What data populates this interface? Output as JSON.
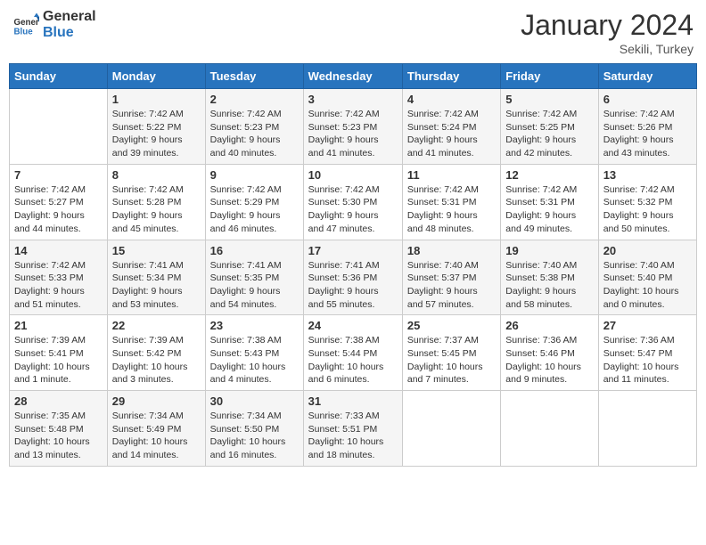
{
  "header": {
    "logo_line1": "General",
    "logo_line2": "Blue",
    "month": "January 2024",
    "location": "Sekili, Turkey"
  },
  "weekdays": [
    "Sunday",
    "Monday",
    "Tuesday",
    "Wednesday",
    "Thursday",
    "Friday",
    "Saturday"
  ],
  "weeks": [
    [
      {
        "day": "",
        "info": ""
      },
      {
        "day": "1",
        "info": "Sunrise: 7:42 AM\nSunset: 5:22 PM\nDaylight: 9 hours\nand 39 minutes."
      },
      {
        "day": "2",
        "info": "Sunrise: 7:42 AM\nSunset: 5:23 PM\nDaylight: 9 hours\nand 40 minutes."
      },
      {
        "day": "3",
        "info": "Sunrise: 7:42 AM\nSunset: 5:23 PM\nDaylight: 9 hours\nand 41 minutes."
      },
      {
        "day": "4",
        "info": "Sunrise: 7:42 AM\nSunset: 5:24 PM\nDaylight: 9 hours\nand 41 minutes."
      },
      {
        "day": "5",
        "info": "Sunrise: 7:42 AM\nSunset: 5:25 PM\nDaylight: 9 hours\nand 42 minutes."
      },
      {
        "day": "6",
        "info": "Sunrise: 7:42 AM\nSunset: 5:26 PM\nDaylight: 9 hours\nand 43 minutes."
      }
    ],
    [
      {
        "day": "7",
        "info": "Sunrise: 7:42 AM\nSunset: 5:27 PM\nDaylight: 9 hours\nand 44 minutes."
      },
      {
        "day": "8",
        "info": "Sunrise: 7:42 AM\nSunset: 5:28 PM\nDaylight: 9 hours\nand 45 minutes."
      },
      {
        "day": "9",
        "info": "Sunrise: 7:42 AM\nSunset: 5:29 PM\nDaylight: 9 hours\nand 46 minutes."
      },
      {
        "day": "10",
        "info": "Sunrise: 7:42 AM\nSunset: 5:30 PM\nDaylight: 9 hours\nand 47 minutes."
      },
      {
        "day": "11",
        "info": "Sunrise: 7:42 AM\nSunset: 5:31 PM\nDaylight: 9 hours\nand 48 minutes."
      },
      {
        "day": "12",
        "info": "Sunrise: 7:42 AM\nSunset: 5:31 PM\nDaylight: 9 hours\nand 49 minutes."
      },
      {
        "day": "13",
        "info": "Sunrise: 7:42 AM\nSunset: 5:32 PM\nDaylight: 9 hours\nand 50 minutes."
      }
    ],
    [
      {
        "day": "14",
        "info": "Sunrise: 7:42 AM\nSunset: 5:33 PM\nDaylight: 9 hours\nand 51 minutes."
      },
      {
        "day": "15",
        "info": "Sunrise: 7:41 AM\nSunset: 5:34 PM\nDaylight: 9 hours\nand 53 minutes."
      },
      {
        "day": "16",
        "info": "Sunrise: 7:41 AM\nSunset: 5:35 PM\nDaylight: 9 hours\nand 54 minutes."
      },
      {
        "day": "17",
        "info": "Sunrise: 7:41 AM\nSunset: 5:36 PM\nDaylight: 9 hours\nand 55 minutes."
      },
      {
        "day": "18",
        "info": "Sunrise: 7:40 AM\nSunset: 5:37 PM\nDaylight: 9 hours\nand 57 minutes."
      },
      {
        "day": "19",
        "info": "Sunrise: 7:40 AM\nSunset: 5:38 PM\nDaylight: 9 hours\nand 58 minutes."
      },
      {
        "day": "20",
        "info": "Sunrise: 7:40 AM\nSunset: 5:40 PM\nDaylight: 10 hours\nand 0 minutes."
      }
    ],
    [
      {
        "day": "21",
        "info": "Sunrise: 7:39 AM\nSunset: 5:41 PM\nDaylight: 10 hours\nand 1 minute."
      },
      {
        "day": "22",
        "info": "Sunrise: 7:39 AM\nSunset: 5:42 PM\nDaylight: 10 hours\nand 3 minutes."
      },
      {
        "day": "23",
        "info": "Sunrise: 7:38 AM\nSunset: 5:43 PM\nDaylight: 10 hours\nand 4 minutes."
      },
      {
        "day": "24",
        "info": "Sunrise: 7:38 AM\nSunset: 5:44 PM\nDaylight: 10 hours\nand 6 minutes."
      },
      {
        "day": "25",
        "info": "Sunrise: 7:37 AM\nSunset: 5:45 PM\nDaylight: 10 hours\nand 7 minutes."
      },
      {
        "day": "26",
        "info": "Sunrise: 7:36 AM\nSunset: 5:46 PM\nDaylight: 10 hours\nand 9 minutes."
      },
      {
        "day": "27",
        "info": "Sunrise: 7:36 AM\nSunset: 5:47 PM\nDaylight: 10 hours\nand 11 minutes."
      }
    ],
    [
      {
        "day": "28",
        "info": "Sunrise: 7:35 AM\nSunset: 5:48 PM\nDaylight: 10 hours\nand 13 minutes."
      },
      {
        "day": "29",
        "info": "Sunrise: 7:34 AM\nSunset: 5:49 PM\nDaylight: 10 hours\nand 14 minutes."
      },
      {
        "day": "30",
        "info": "Sunrise: 7:34 AM\nSunset: 5:50 PM\nDaylight: 10 hours\nand 16 minutes."
      },
      {
        "day": "31",
        "info": "Sunrise: 7:33 AM\nSunset: 5:51 PM\nDaylight: 10 hours\nand 18 minutes."
      },
      {
        "day": "",
        "info": ""
      },
      {
        "day": "",
        "info": ""
      },
      {
        "day": "",
        "info": ""
      }
    ]
  ]
}
